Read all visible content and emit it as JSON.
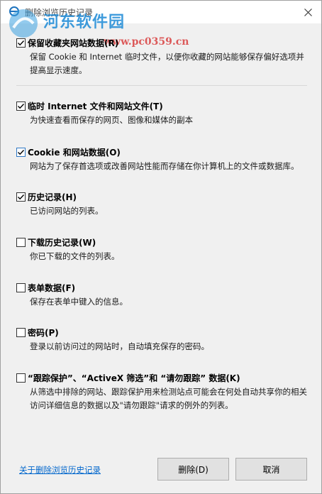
{
  "window": {
    "title": "删除浏览历史记录"
  },
  "watermark": {
    "name": "河东软件园",
    "url": "www.pc0359.cn"
  },
  "options": [
    {
      "label": "保留收藏夹网站数据(R)",
      "description": "保留 Cookie 和 Internet 临时文件，以便你收藏的网站能够保存偏好选项并提高显示速度。",
      "checked": true
    },
    {
      "label": "临时 Internet 文件和网站文件(T)",
      "description": "为快速查看而保存的网页、图像和媒体的副本",
      "checked": true
    },
    {
      "label": "Cookie 和网站数据(O)",
      "description": "网站为了保存首选项或改善网站性能而存储在你计算机上的文件或数据库。",
      "checked": true
    },
    {
      "label": "历史记录(H)",
      "description": "已访问网站的列表。",
      "checked": true
    },
    {
      "label": "下载历史记录(W)",
      "description": "你已下载的文件的列表。",
      "checked": false
    },
    {
      "label": "表单数据(F)",
      "description": "保存在表单中键入的信息。",
      "checked": false
    },
    {
      "label": "密码(P)",
      "description": "登录以前访问过的网站时，自动填充保存的密码。",
      "checked": false
    },
    {
      "label": "“跟踪保护”、“ActiveX 筛选”和 “请勿跟踪” 数据(K)",
      "description": "从筛选中排除的网站、跟踪保护用来检测站点可能会在何处自动共享你的相关访问详细信息的数据以及\"请勿跟踪\"请求的例外的列表。",
      "checked": false
    }
  ],
  "footer": {
    "about_link": "关于删除浏览历史记录",
    "delete_button": "删除(D)",
    "cancel_button": "取消"
  },
  "colors": {
    "link": "#0066cc",
    "checkmark": "#000000",
    "focus_checkbox": "#2f78c4",
    "watermark_name": "#1d8ad6",
    "watermark_url": "#d94040"
  }
}
